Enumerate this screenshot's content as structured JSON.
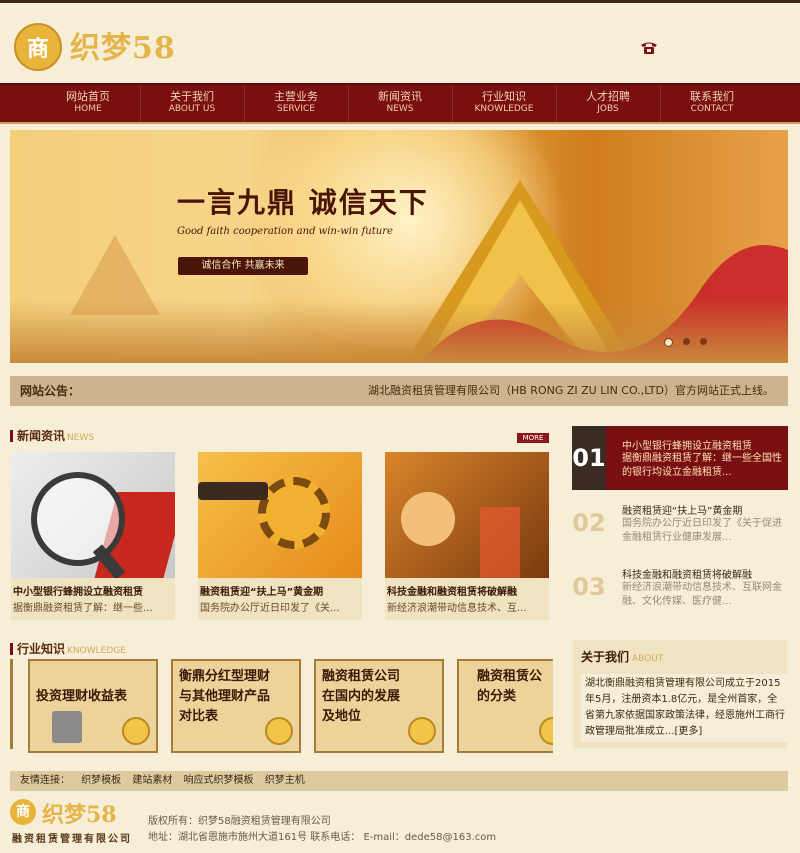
{
  "header": {
    "logo_mark": "商",
    "logo_text": "织梦58",
    "phone_icon": "phone-icon"
  },
  "nav": [
    {
      "cn": "网站首页",
      "en": "HOME"
    },
    {
      "cn": "关于我们",
      "en": "ABOUT US"
    },
    {
      "cn": "主营业务",
      "en": "SERVICE"
    },
    {
      "cn": "新闻资讯",
      "en": "NEWS"
    },
    {
      "cn": "行业知识",
      "en": "KNOWLEDGE"
    },
    {
      "cn": "人才招聘",
      "en": "JOBS"
    },
    {
      "cn": "联系我们",
      "en": "CONTACT"
    }
  ],
  "banner": {
    "slogan": "一言九鼎 诚信天下",
    "slogan_en": "Good faith cooperation and win-win future",
    "tag": "诚信合作 共赢未来"
  },
  "notice": {
    "label": "网站公告：",
    "text": "湖北融资租赁管理有限公司（HB RONG ZI ZU LIN CO.,LTD）官方网站正式上线。"
  },
  "news": {
    "title": "新闻资讯",
    "title_en": "NEWS",
    "more": "MORE",
    "cards": [
      {
        "title": "中小型银行蜂拥设立融资租赁",
        "desc": "据衡鼎融资租赁了解：继一些..."
      },
      {
        "title": "融资租赁迎“扶上马”黄金期",
        "desc": "国务院办公厅近日印发了《关..."
      },
      {
        "title": "科技金融和融资租赁将破解融",
        "desc": "新经济浪潮带动信息技术、互..."
      }
    ],
    "ranked": [
      {
        "num": "01",
        "title": "中小型银行蜂拥设立融资租赁",
        "desc": "据衡鼎融资租赁了解：继一些全国性的银行均设立金融租赁..."
      },
      {
        "num": "02",
        "title": "融资租赁迎“扶上马”黄金期",
        "desc": "国务院办公厅近日印发了《关于促进金融租赁行业健康发展..."
      },
      {
        "num": "03",
        "title": "科技金融和融资租赁将破解融",
        "desc": "新经济浪潮带动信息技术、互联网金融、文化传媒、医疗健..."
      }
    ]
  },
  "knowledge": {
    "title": "行业知识",
    "title_en": "KNOWLEDGE",
    "cards": [
      {
        "l1": "投资理财收益表",
        "l2": "",
        "l3": ""
      },
      {
        "l1": "衡鼎分红型理财",
        "l2": "与其他理财产品",
        "l3": "对比表"
      },
      {
        "l1": "融资租赁公司",
        "l2": "在国内的发展",
        "l3": "及地位"
      },
      {
        "l1": "融资租赁公",
        "l2": "的分类",
        "l3": ""
      }
    ]
  },
  "about": {
    "title": "关于我们",
    "title_en": "ABOUT",
    "text": "湖北衡鼎融资租赁管理有限公司成立于2015年5月，注册资本1.8亿元，是全州首家，全省第九家依据国家政策法律，经恩施州工商行政管理局批准成立...[更多]"
  },
  "links": {
    "label": "友情连接：",
    "items": [
      "织梦模板",
      "建站素材",
      "响应式织梦模板",
      "织梦主机"
    ]
  },
  "footer": {
    "seal": "商",
    "logo": "织梦58",
    "sub": "融资租赁管理有限公司",
    "copyright": "版权所有：织梦58融资租赁管理有限公司",
    "address": "地址：湖北省恩施市施州大道161号 联系电话： E-mail：dede58@163.com"
  }
}
